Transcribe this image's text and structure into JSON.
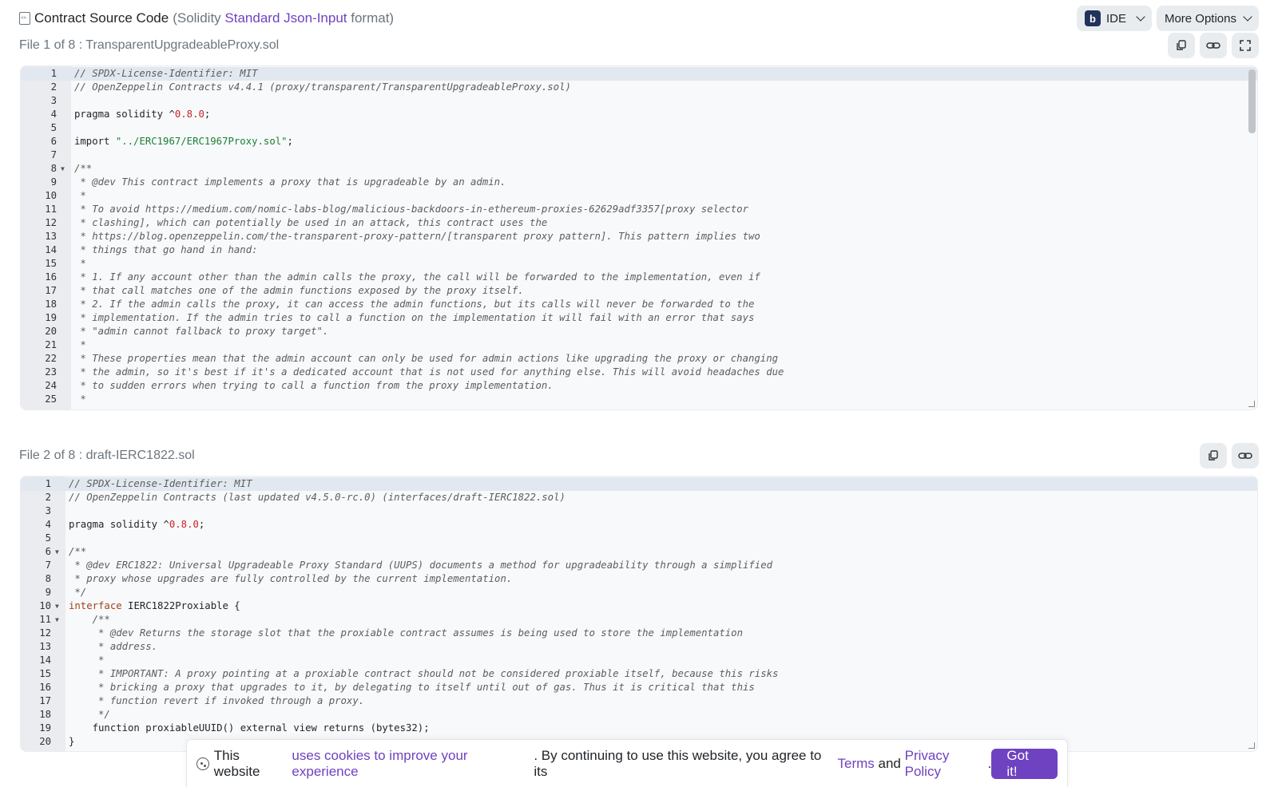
{
  "header": {
    "title": "Contract Source Code",
    "meta_prefix": "(Solidity",
    "meta_link": "Standard Json-Input",
    "meta_suffix": "format)",
    "ide_logo": "b",
    "ide_label": "IDE",
    "more_options_label": "More Options"
  },
  "files": [
    {
      "label": "File 1 of 8 : TransparentUpgradeableProxy.sol",
      "lines": [
        [
          [
            "c",
            "// SPDX-License-Identifier: MIT"
          ]
        ],
        [
          [
            "c",
            "// OpenZeppelin Contracts v4.4.1 (proxy/transparent/TransparentUpgradeableProxy.sol)"
          ]
        ],
        [],
        [
          [
            "t",
            "pragma solidity ^"
          ],
          [
            "n",
            "0.8.0"
          ],
          [
            "t",
            ";"
          ]
        ],
        [],
        [
          [
            "t",
            "import "
          ],
          [
            "s",
            "\"../ERC1967/ERC1967Proxy.sol\""
          ],
          [
            "t",
            ";"
          ]
        ],
        [],
        [
          [
            "c",
            "/**"
          ]
        ],
        [
          [
            "c",
            " * @dev This contract implements a proxy that is upgradeable by an admin."
          ]
        ],
        [
          [
            "c",
            " *"
          ]
        ],
        [
          [
            "c",
            " * To avoid https://medium.com/nomic-labs-blog/malicious-backdoors-in-ethereum-proxies-62629adf3357[proxy selector"
          ]
        ],
        [
          [
            "c",
            " * clashing], which can potentially be used in an attack, this contract uses the"
          ]
        ],
        [
          [
            "c",
            " * https://blog.openzeppelin.com/the-transparent-proxy-pattern/[transparent proxy pattern]. This pattern implies two"
          ]
        ],
        [
          [
            "c",
            " * things that go hand in hand:"
          ]
        ],
        [
          [
            "c",
            " *"
          ]
        ],
        [
          [
            "c",
            " * 1. If any account other than the admin calls the proxy, the call will be forwarded to the implementation, even if"
          ]
        ],
        [
          [
            "c",
            " * that call matches one of the admin functions exposed by the proxy itself."
          ]
        ],
        [
          [
            "c",
            " * 2. If the admin calls the proxy, it can access the admin functions, but its calls will never be forwarded to the"
          ]
        ],
        [
          [
            "c",
            " * implementation. If the admin tries to call a function on the implementation it will fail with an error that says"
          ]
        ],
        [
          [
            "c",
            " * \"admin cannot fallback to proxy target\"."
          ]
        ],
        [
          [
            "c",
            " *"
          ]
        ],
        [
          [
            "c",
            " * These properties mean that the admin account can only be used for admin actions like upgrading the proxy or changing"
          ]
        ],
        [
          [
            "c",
            " * the admin, so it's best if it's a dedicated account that is not used for anything else. This will avoid headaches due"
          ]
        ],
        [
          [
            "c",
            " * to sudden errors when trying to call a function from the proxy implementation."
          ]
        ],
        [
          [
            "c",
            " *"
          ]
        ]
      ]
    },
    {
      "label": "File 2 of 8 : draft-IERC1822.sol",
      "lines": [
        [
          [
            "c",
            "// SPDX-License-Identifier: MIT"
          ]
        ],
        [
          [
            "c",
            "// OpenZeppelin Contracts (last updated v4.5.0-rc.0) (interfaces/draft-IERC1822.sol)"
          ]
        ],
        [],
        [
          [
            "t",
            "pragma solidity ^"
          ],
          [
            "n",
            "0.8.0"
          ],
          [
            "t",
            ";"
          ]
        ],
        [],
        [
          [
            "c",
            "/**"
          ]
        ],
        [
          [
            "c",
            " * @dev ERC1822: Universal Upgradeable Proxy Standard (UUPS) documents a method for upgradeability through a simplified"
          ]
        ],
        [
          [
            "c",
            " * proxy whose upgrades are fully controlled by the current implementation."
          ]
        ],
        [
          [
            "c",
            " */"
          ]
        ],
        [
          [
            "k",
            "interface"
          ],
          [
            "t",
            " IERC1822Proxiable {"
          ]
        ],
        [
          [
            "c",
            "    /**"
          ]
        ],
        [
          [
            "c",
            "     * @dev Returns the storage slot that the proxiable contract assumes is being used to store the implementation"
          ]
        ],
        [
          [
            "c",
            "     * address."
          ]
        ],
        [
          [
            "c",
            "     *"
          ]
        ],
        [
          [
            "c",
            "     * IMPORTANT: A proxy pointing at a proxiable contract should not be considered proxiable itself, because this risks"
          ]
        ],
        [
          [
            "c",
            "     * bricking a proxy that upgrades to it, by delegating to itself until out of gas. Thus it is critical that this"
          ]
        ],
        [
          [
            "c",
            "     * function revert if invoked through a proxy."
          ]
        ],
        [
          [
            "c",
            "     */"
          ]
        ],
        [
          [
            "t",
            "    function proxiableUUID() external view returns (bytes32);"
          ]
        ],
        [
          [
            "t",
            "}"
          ]
        ]
      ]
    }
  ],
  "cookie": {
    "text1": "This website",
    "link1": "uses cookies to improve your experience",
    "text2": ". By continuing to use this website, you agree to its",
    "link2": "Terms",
    "text3": "and",
    "link3": "Privacy Policy",
    "text4": ".",
    "button": "Got it!"
  }
}
